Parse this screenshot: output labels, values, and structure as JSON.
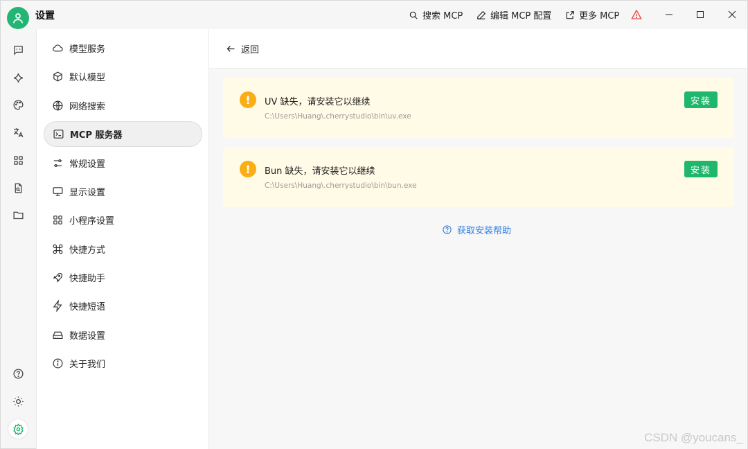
{
  "titlebar": {
    "title": "设置",
    "search_mcp": "搜索 MCP",
    "edit_mcp_config": "编辑 MCP 配置",
    "more_mcp": "更多 MCP"
  },
  "settings_nav": {
    "items": [
      {
        "label": "模型服务",
        "icon": "cloud-icon"
      },
      {
        "label": "默认模型",
        "icon": "cube-icon"
      },
      {
        "label": "网络搜索",
        "icon": "globe-icon"
      },
      {
        "label": "MCP 服务器",
        "icon": "terminal-icon",
        "active": true
      },
      {
        "label": "常规设置",
        "icon": "sliders-icon"
      },
      {
        "label": "显示设置",
        "icon": "monitor-icon"
      },
      {
        "label": "小程序设置",
        "icon": "grid-icon"
      },
      {
        "label": "快捷方式",
        "icon": "command-icon"
      },
      {
        "label": "快捷助手",
        "icon": "rocket-icon"
      },
      {
        "label": "快捷短语",
        "icon": "zap-icon"
      },
      {
        "label": "数据设置",
        "icon": "hard-drive-icon"
      },
      {
        "label": "关于我们",
        "icon": "info-icon"
      }
    ]
  },
  "main": {
    "back_label": "返回",
    "alerts": [
      {
        "title": "UV 缺失，请安装它以继续",
        "path": "C:\\Users\\Huang\\.cherrystudio\\bin\\uv.exe",
        "button": "安装"
      },
      {
        "title": "Bun 缺失，请安装它以继续",
        "path": "C:\\Users\\Huang\\.cherrystudio\\bin\\bun.exe",
        "button": "安装"
      }
    ],
    "help_link": "获取安装帮助"
  },
  "watermark": "CSDN @youcans_",
  "colors": {
    "accent_green": "#1fb76b",
    "warning": "#faad14",
    "alert_bg": "#fffbe6",
    "link": "#2f7de1"
  }
}
